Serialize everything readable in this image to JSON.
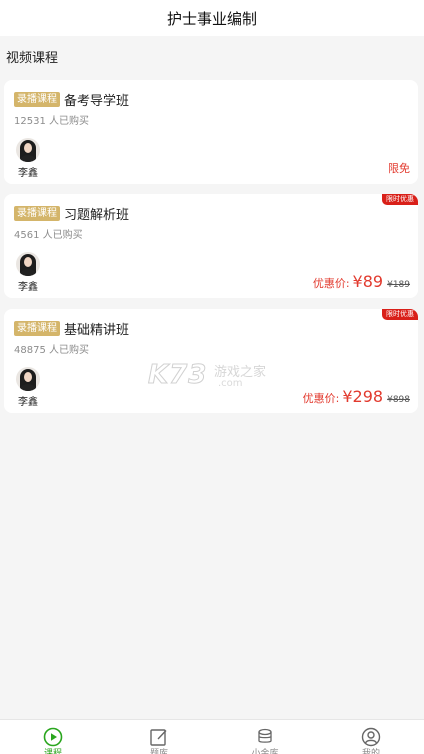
{
  "header": {
    "title": "护士事业编制"
  },
  "section": {
    "title": "视频课程"
  },
  "courses": [
    {
      "tag": "录播课程",
      "title": "备考导学班",
      "buyers": "12531 人已购买",
      "teacher": "李鑫",
      "free_label": "限免"
    },
    {
      "tag": "录播课程",
      "title": "习题解析班",
      "buyers": "4561 人已购买",
      "teacher": "李鑫",
      "ribbon": "限时优惠",
      "price_label": "优惠价:",
      "price": "¥89",
      "original_price": "¥189"
    },
    {
      "tag": "录播课程",
      "title": "基础精讲班",
      "buyers": "48875 人已购买",
      "teacher": "李鑫",
      "ribbon": "限时优惠",
      "price_label": "优惠价:",
      "price": "¥298",
      "original_price": "¥898"
    }
  ],
  "watermark": {
    "brand": "K73",
    "cn": "游戏之家",
    "url": ".com"
  },
  "tabbar": {
    "active_color": "#2aa61e",
    "items": [
      {
        "label": "课程",
        "icon": "play-circle-icon"
      },
      {
        "label": "题库",
        "icon": "edit-icon"
      },
      {
        "label": "小金库",
        "icon": "coins-icon"
      },
      {
        "label": "我的",
        "icon": "user-icon"
      }
    ]
  }
}
